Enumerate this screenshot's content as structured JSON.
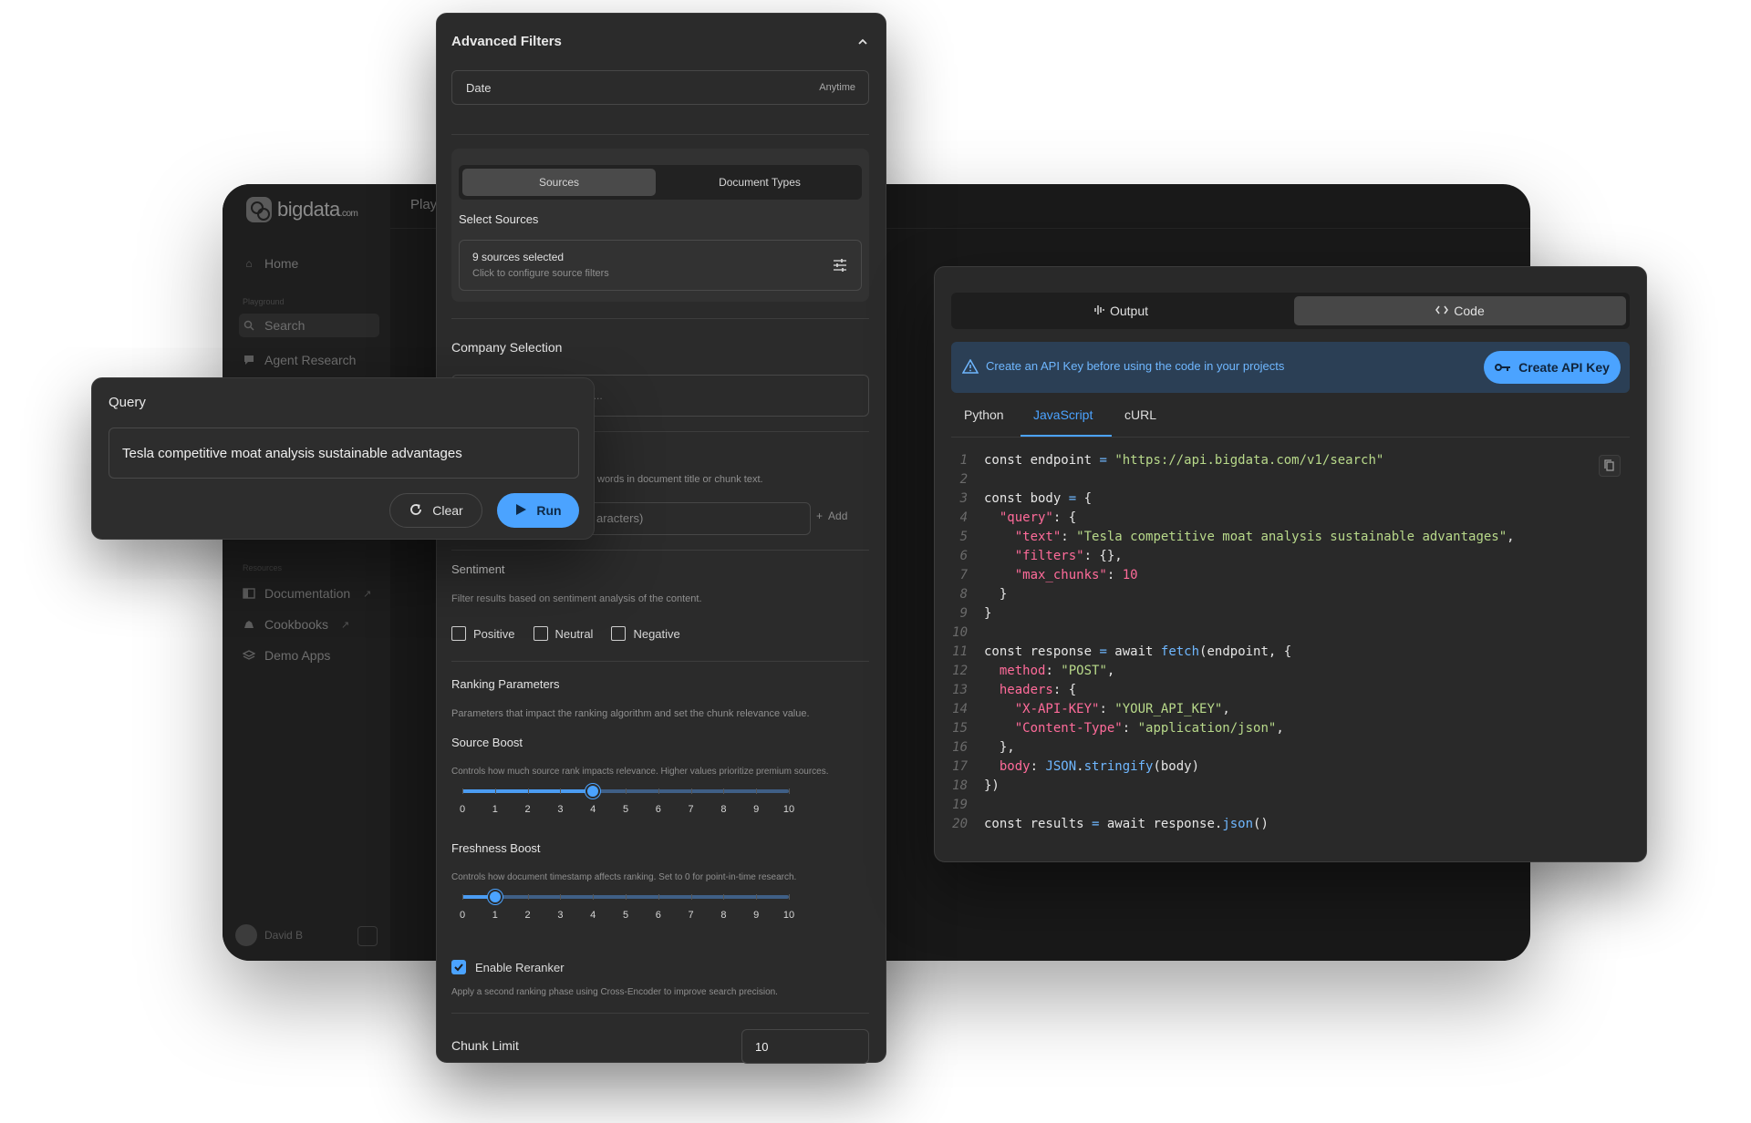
{
  "app": {
    "logo_text": "bigdata",
    "logo_suffix": ".com",
    "topbar_title": "Play",
    "nav": {
      "home": "Home",
      "section_playground": "Playground",
      "search": "Search",
      "agent_research": "Agent Research",
      "section_resources": "Resources",
      "documentation": "Documentation",
      "cookbooks": "Cookbooks",
      "demo_apps": "Demo Apps"
    },
    "user_name": "David B"
  },
  "filters": {
    "title": "Advanced Filters",
    "date_label": "Date",
    "date_value": "Anytime",
    "tabs": [
      "Sources",
      "Document Types"
    ],
    "select_sources_label": "Select Sources",
    "sources_count": "9 sources selected",
    "sources_hint": "Click to configure source filters",
    "company_label": "Company Selection",
    "company_placeholder_tail": "ies ...",
    "keywords_hint_tail": "words in document title or chunk text.",
    "keywords_input_tail": "aracters)",
    "keywords_add": "Add",
    "sentiment_label": "Sentiment",
    "sentiment_desc": "Filter results based on sentiment analysis of the content.",
    "sentiment_options": [
      "Positive",
      "Neutral",
      "Negative"
    ],
    "ranking_label": "Ranking Parameters",
    "ranking_desc": "Parameters that impact the ranking algorithm and set the chunk relevance value.",
    "source_boost": {
      "label": "Source Boost",
      "desc": "Controls how much source rank impacts relevance. Higher values prioritize premium sources.",
      "value": 4,
      "min": 0,
      "max": 10
    },
    "freshness_boost": {
      "label": "Freshness Boost",
      "desc": "Controls how document timestamp affects ranking. Set to 0 for point-in-time research.",
      "value": 1,
      "min": 0,
      "max": 10
    },
    "tick_labels": [
      "0",
      "1",
      "2",
      "3",
      "4",
      "5",
      "6",
      "7",
      "8",
      "9",
      "10"
    ],
    "reranker_label": "Enable Reranker",
    "reranker_checked": true,
    "reranker_desc": "Apply a second ranking phase using Cross-Encoder to improve search precision.",
    "chunk_limit_label": "Chunk Limit",
    "chunk_limit_value": "10"
  },
  "query": {
    "title": "Query",
    "text": "Tesla competitive moat analysis sustainable advantages",
    "clear_label": "Clear",
    "run_label": "Run"
  },
  "code_panel": {
    "tab_output": "Output",
    "tab_code": "Code",
    "alert_text": "Create an API Key before using the code in your projects",
    "api_button": "Create API Key",
    "lang_tabs": [
      "Python",
      "JavaScript",
      "cURL"
    ],
    "active_lang": "JavaScript",
    "line_numbers": [
      "1",
      "2",
      "3",
      "4",
      "5",
      "6",
      "7",
      "8",
      "9",
      "10",
      "11",
      "12",
      "13",
      "14",
      "15",
      "16",
      "17",
      "18",
      "19",
      "20"
    ]
  },
  "colors": {
    "accent": "#4ba3ff",
    "panel_bg": "#2b2b2b",
    "app_bg": "#191919",
    "string": "#b8d98a",
    "key": "#ff6b9a"
  }
}
